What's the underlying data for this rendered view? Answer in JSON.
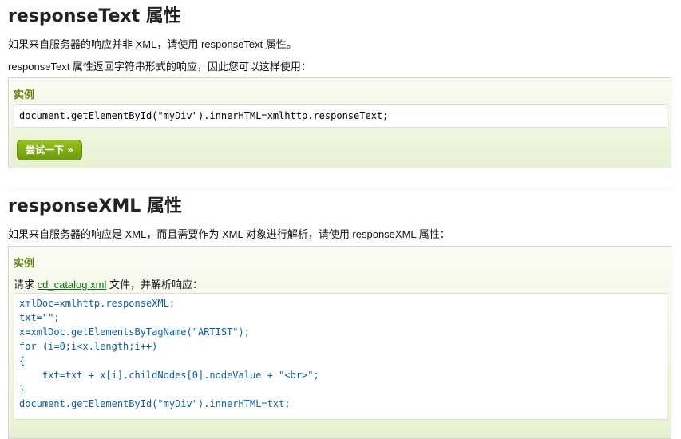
{
  "section1": {
    "title": "responseText 属性",
    "desc1": "如果来自服务器的响应并非 XML，请使用 responseText 属性。",
    "desc2": "responseText 属性返回字符串形式的响应，因此您可以这样使用：",
    "example_title": "实例",
    "code": "document.getElementById(\"myDiv\").innerHTML=xmlhttp.responseText;",
    "try_button": "尝试一下 »"
  },
  "section2": {
    "title": "responseXML 属性",
    "desc": "如果来自服务器的响应是 XML，而且需要作为 XML 对象进行解析，请使用 responseXML 属性：",
    "example_title": "实例",
    "request_prefix": "请求 ",
    "request_link": "cd_catalog.xml",
    "request_suffix": " 文件，并解析响应：",
    "code_lines": [
      "xmlDoc=xmlhttp.responseXML;",
      "txt=\"\";",
      "x=xmlDoc.getElementsByTagName(\"ARTIST\");",
      "for (i=0;i<x.length;i++)",
      "{",
      "    txt=txt + x[i].childNodes[0].nodeValue + \"<br>\";",
      "}",
      "document.getElementById(\"myDiv\").innerHTML=txt;"
    ]
  }
}
